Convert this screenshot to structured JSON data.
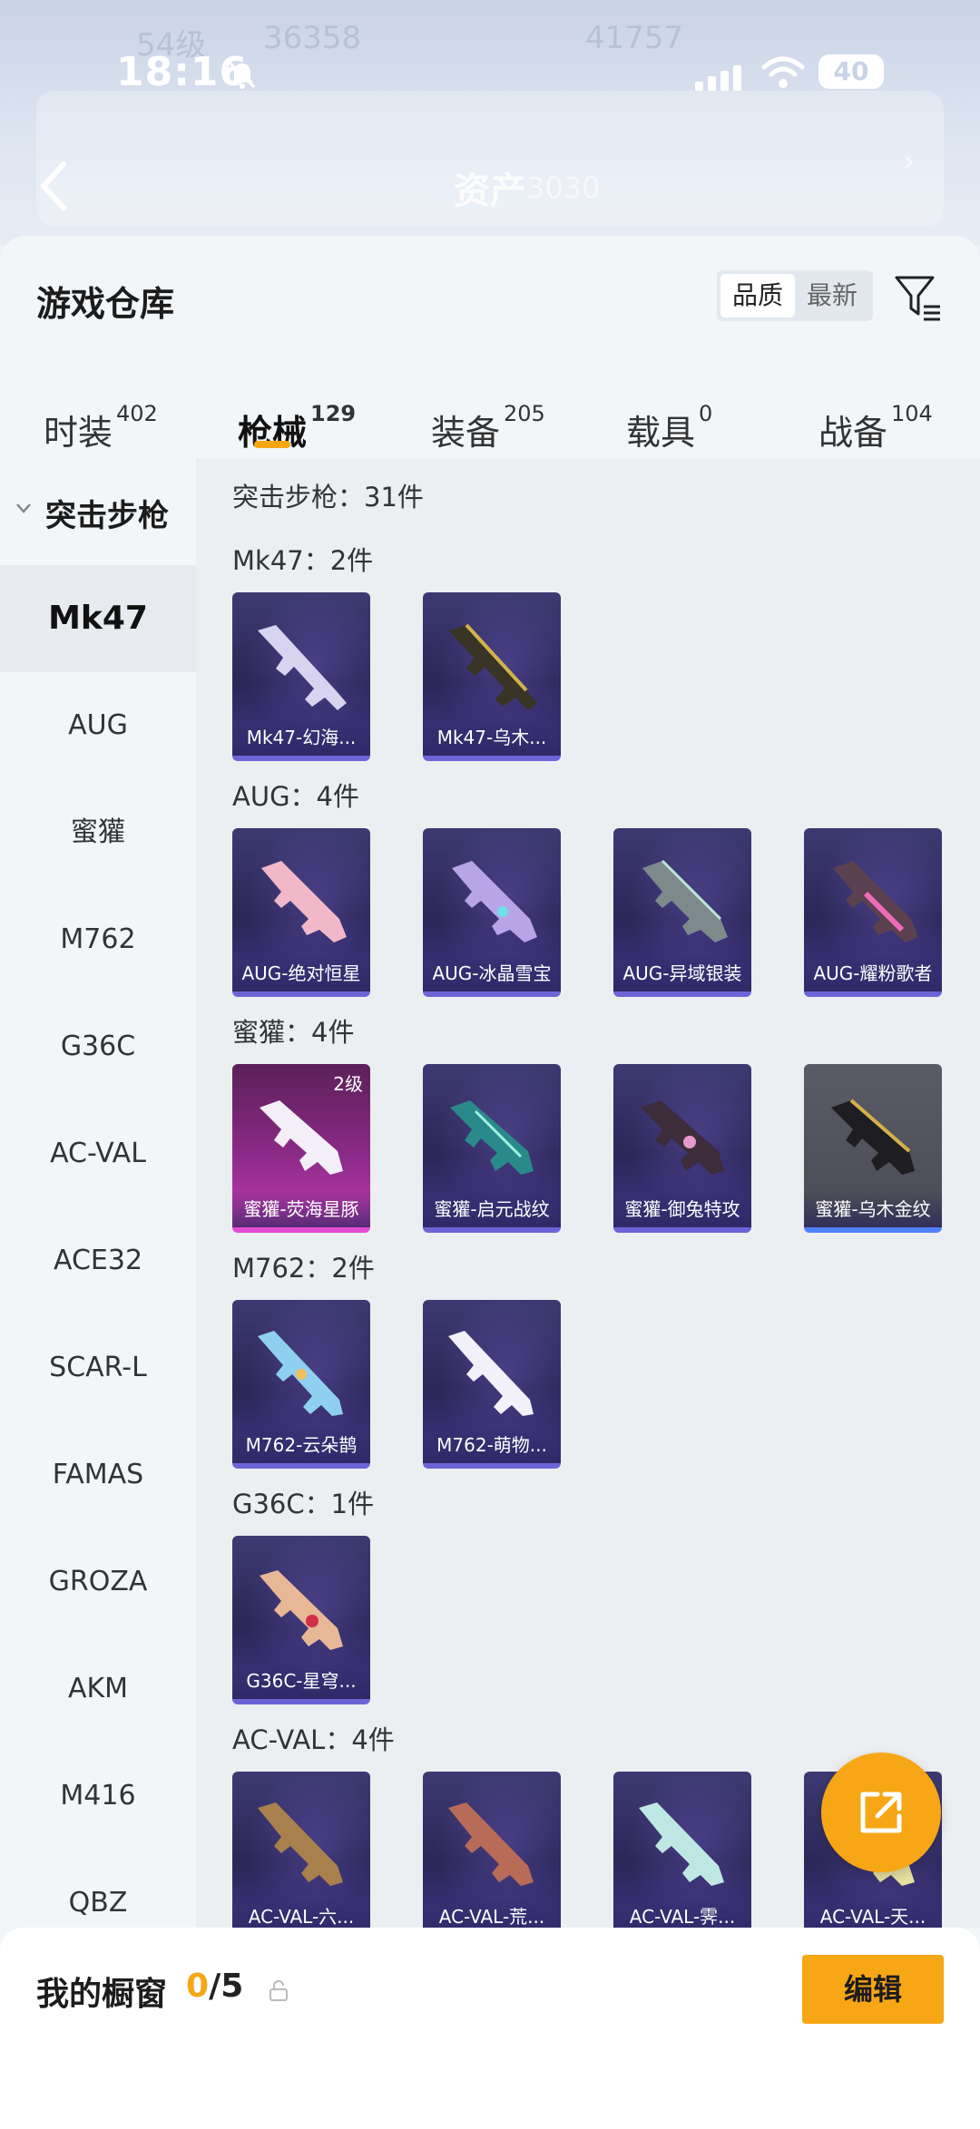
{
  "status_bar": {
    "time": "18:16",
    "battery": "40"
  },
  "background": {
    "left_level": "54级",
    "left_coins": "36358",
    "right_coins": "41757",
    "assets_label": "资产",
    "assets_value": "3030"
  },
  "header": {
    "title": "游戏仓库",
    "sort_options": [
      "品质",
      "最新"
    ],
    "sort_selected": "品质"
  },
  "tabs": [
    {
      "label": "时装",
      "count": "402"
    },
    {
      "label": "枪械",
      "count": "129",
      "selected": true
    },
    {
      "label": "装备",
      "count": "205"
    },
    {
      "label": "载具",
      "count": "0"
    },
    {
      "label": "战备",
      "count": "104"
    }
  ],
  "sidebar": {
    "category": "突击步枪",
    "items": [
      "Mk47",
      "AUG",
      "蜜獾",
      "M762",
      "G36C",
      "AC-VAL",
      "ACE32",
      "SCAR-L",
      "FAMAS",
      "GROZA",
      "AKM",
      "M416",
      "QBZ"
    ],
    "selected": "Mk47"
  },
  "content": {
    "summary": "突击步枪：31件",
    "groups": [
      {
        "title": "Mk47：2件",
        "cards": [
          {
            "name": "Mk47-幻海..."
          },
          {
            "name": "Mk47-乌木..."
          }
        ]
      },
      {
        "title": "AUG：4件",
        "cards": [
          {
            "name": "AUG-绝对恒星"
          },
          {
            "name": "AUG-冰晶雪宝"
          },
          {
            "name": "AUG-异域银装"
          },
          {
            "name": "AUG-耀粉歌者"
          }
        ]
      },
      {
        "title": "蜜獾：4件",
        "cards": [
          {
            "name": "蜜獾-荧海星豚",
            "level": "2级"
          },
          {
            "name": "蜜獾-启元战纹"
          },
          {
            "name": "蜜獾-御兔特攻"
          },
          {
            "name": "蜜獾-乌木金纹"
          }
        ]
      },
      {
        "title": "M762：2件",
        "cards": [
          {
            "name": "M762-云朵鹊"
          },
          {
            "name": "M762-萌物..."
          }
        ]
      },
      {
        "title": "G36C：1件",
        "cards": [
          {
            "name": "G36C-星穹..."
          }
        ]
      },
      {
        "title": "AC-VAL：4件",
        "cards": [
          {
            "name": "AC-VAL-六..."
          },
          {
            "name": "AC-VAL-荒..."
          },
          {
            "name": "AC-VAL-霁..."
          },
          {
            "name": "AC-VAL-天..."
          }
        ]
      }
    ]
  },
  "showcase": {
    "label": "我的橱窗",
    "used": "0",
    "total": "/5",
    "edit_label": "编辑"
  },
  "colors": {
    "accent": "#f7a615",
    "card_purple": "#2b2757",
    "card_pink": "#8a2a87",
    "card_gray": "#4a4b55"
  }
}
